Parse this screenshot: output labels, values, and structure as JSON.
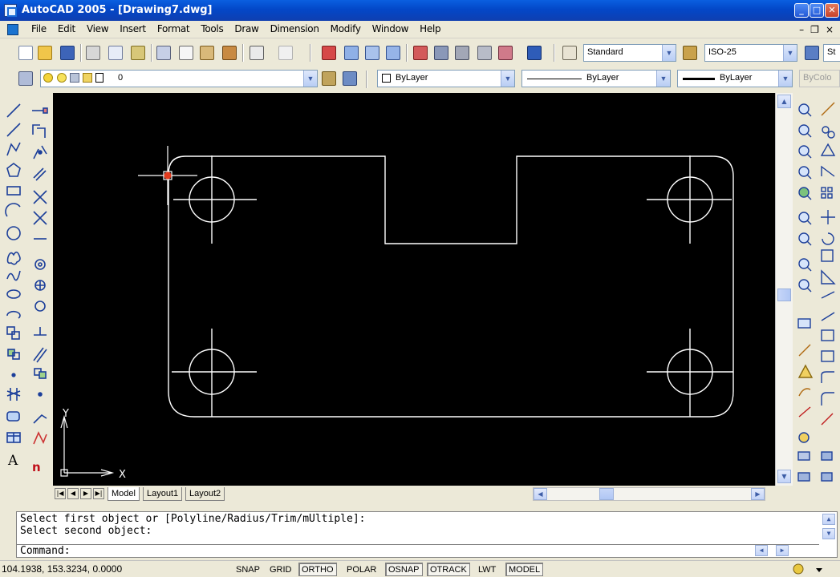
{
  "window": {
    "title": "AutoCAD 2005 - [Drawing7.dwg]",
    "controls": {
      "minimize": "_",
      "maximize": "□",
      "close": "✕"
    }
  },
  "menubar": {
    "items": [
      "File",
      "Edit",
      "View",
      "Insert",
      "Format",
      "Tools",
      "Draw",
      "Dimension",
      "Modify",
      "Window",
      "Help"
    ],
    "mdi_controls": {
      "minimize": "–",
      "restore": "❐",
      "close": "×"
    }
  },
  "toolbar": {
    "text_style": "Standard",
    "dim_style": "ISO-25",
    "table_style_partial": "St",
    "layer": "0",
    "color": "ByLayer",
    "linetype": "ByLayer",
    "lineweight": "ByLayer",
    "plot_style": "ByColo"
  },
  "drawing": {
    "axis_x_label": "X",
    "axis_y_label": "Y"
  },
  "layout_tabs": [
    "Model",
    "Layout1",
    "Layout2"
  ],
  "nav_buttons": [
    "|◀",
    "◀",
    "▶",
    "▶|"
  ],
  "command": {
    "lines": [
      "Select first object or [Polyline/Radius/Trim/mUltiple]:",
      "Select second object:"
    ],
    "prompt": "Command:"
  },
  "statusbar": {
    "coordinates": "104.1938, 153.3234, 0.0000",
    "toggles": [
      {
        "label": "SNAP",
        "on": false
      },
      {
        "label": "GRID",
        "on": false
      },
      {
        "label": "ORTHO",
        "on": true
      },
      {
        "label": "POLAR",
        "on": false
      },
      {
        "label": "OSNAP",
        "on": true
      },
      {
        "label": "OTRACK",
        "on": true
      },
      {
        "label": "LWT",
        "on": false
      },
      {
        "label": "MODEL",
        "on": true
      }
    ]
  },
  "colors": {
    "titlebar": "#0a5fe0",
    "canvas_background": "#000000",
    "drawing_lines": "#ffffff",
    "cursor_marker": "#e23b1e"
  }
}
